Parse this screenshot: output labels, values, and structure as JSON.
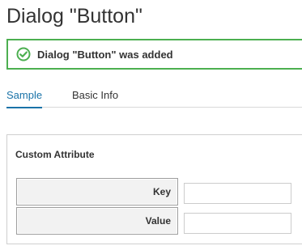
{
  "page": {
    "title": "Dialog \"Button\""
  },
  "alert": {
    "message": "Dialog \"Button\" was added",
    "icon": "check-circle-icon",
    "color": "#4caf50"
  },
  "tabs": [
    {
      "label": "Sample",
      "active": true
    },
    {
      "label": "Basic Info",
      "active": false
    }
  ],
  "panel": {
    "title": "Custom Attribute",
    "fields": [
      {
        "label": "Key",
        "value": "",
        "placeholder": ""
      },
      {
        "label": "Value",
        "value": "",
        "placeholder": ""
      }
    ]
  },
  "colors": {
    "accent": "#1a73a8",
    "success": "#4caf50"
  }
}
